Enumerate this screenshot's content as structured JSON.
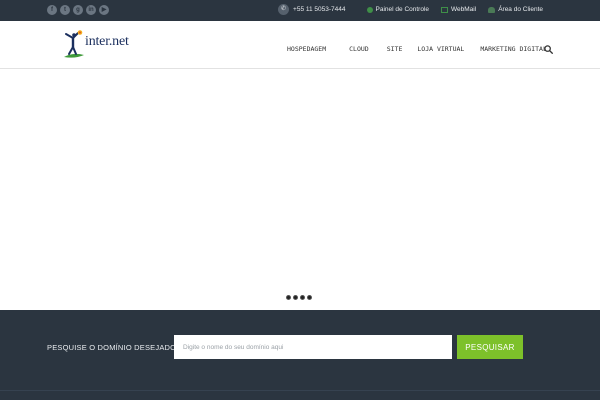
{
  "topbar": {
    "social": [
      {
        "icon": "facebook-icon",
        "glyph": "f"
      },
      {
        "icon": "twitter-icon",
        "glyph": "t"
      },
      {
        "icon": "googleplus-icon",
        "glyph": "g"
      },
      {
        "icon": "linkedin-icon",
        "glyph": "in"
      },
      {
        "icon": "youtube-icon",
        "glyph": "▶"
      }
    ],
    "phone": "+55 11 5053-7444",
    "links": [
      {
        "label": "Painel de Controle",
        "icon": "panel-icon"
      },
      {
        "label": "WebMail",
        "icon": "mail-icon"
      },
      {
        "label": "Área do Cliente",
        "icon": "user-icon"
      }
    ]
  },
  "header": {
    "logo_text": "inter.net",
    "nav": [
      "HOSPEDAGEM",
      "CLOUD",
      "SITE",
      "LOJA VIRTUAL",
      "MARKETING DIGITAL"
    ]
  },
  "slider": {
    "dots": 4
  },
  "domain_search": {
    "label": "PESQUISE O DOMÍNIO DESEJADO:",
    "placeholder": "Digite o nome do seu domínio aqui",
    "button": "PESQUISAR"
  },
  "colors": {
    "dark": "#2b3540",
    "accent_green": "#7dc12a",
    "logo_blue": "#1b2f5e"
  }
}
